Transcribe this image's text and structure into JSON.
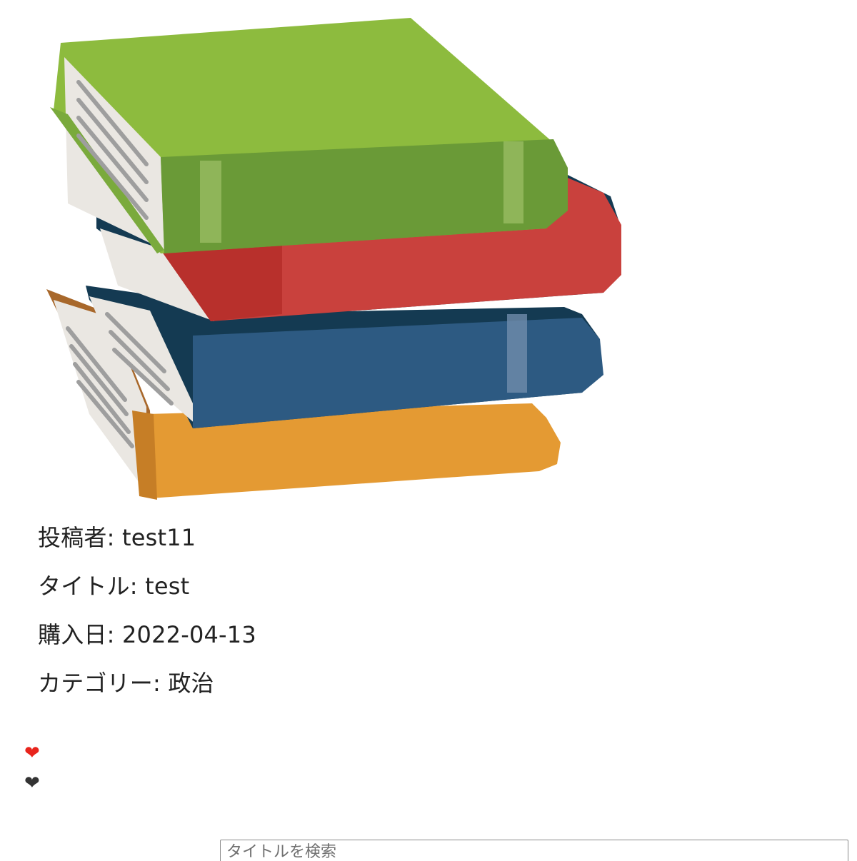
{
  "post": {
    "poster_label": "投稿者: test11",
    "title_label": "タイトル: test",
    "purchase_date_label": "購入日: 2022-04-13",
    "category_label": "カテゴリー: 政治"
  },
  "likes": {
    "liked_icon": "heart-icon",
    "liked_color": "#e8241c",
    "unliked_icon": "heart-icon",
    "unliked_color": "#333333"
  },
  "search": {
    "placeholder": "タイトルを検索",
    "value": ""
  },
  "image": {
    "icon": "books-stack-icon",
    "colors": {
      "green": "#7aaa3c",
      "red": "#c9413d",
      "blue": "#2d5a82",
      "yellow": "#e49a33"
    }
  }
}
